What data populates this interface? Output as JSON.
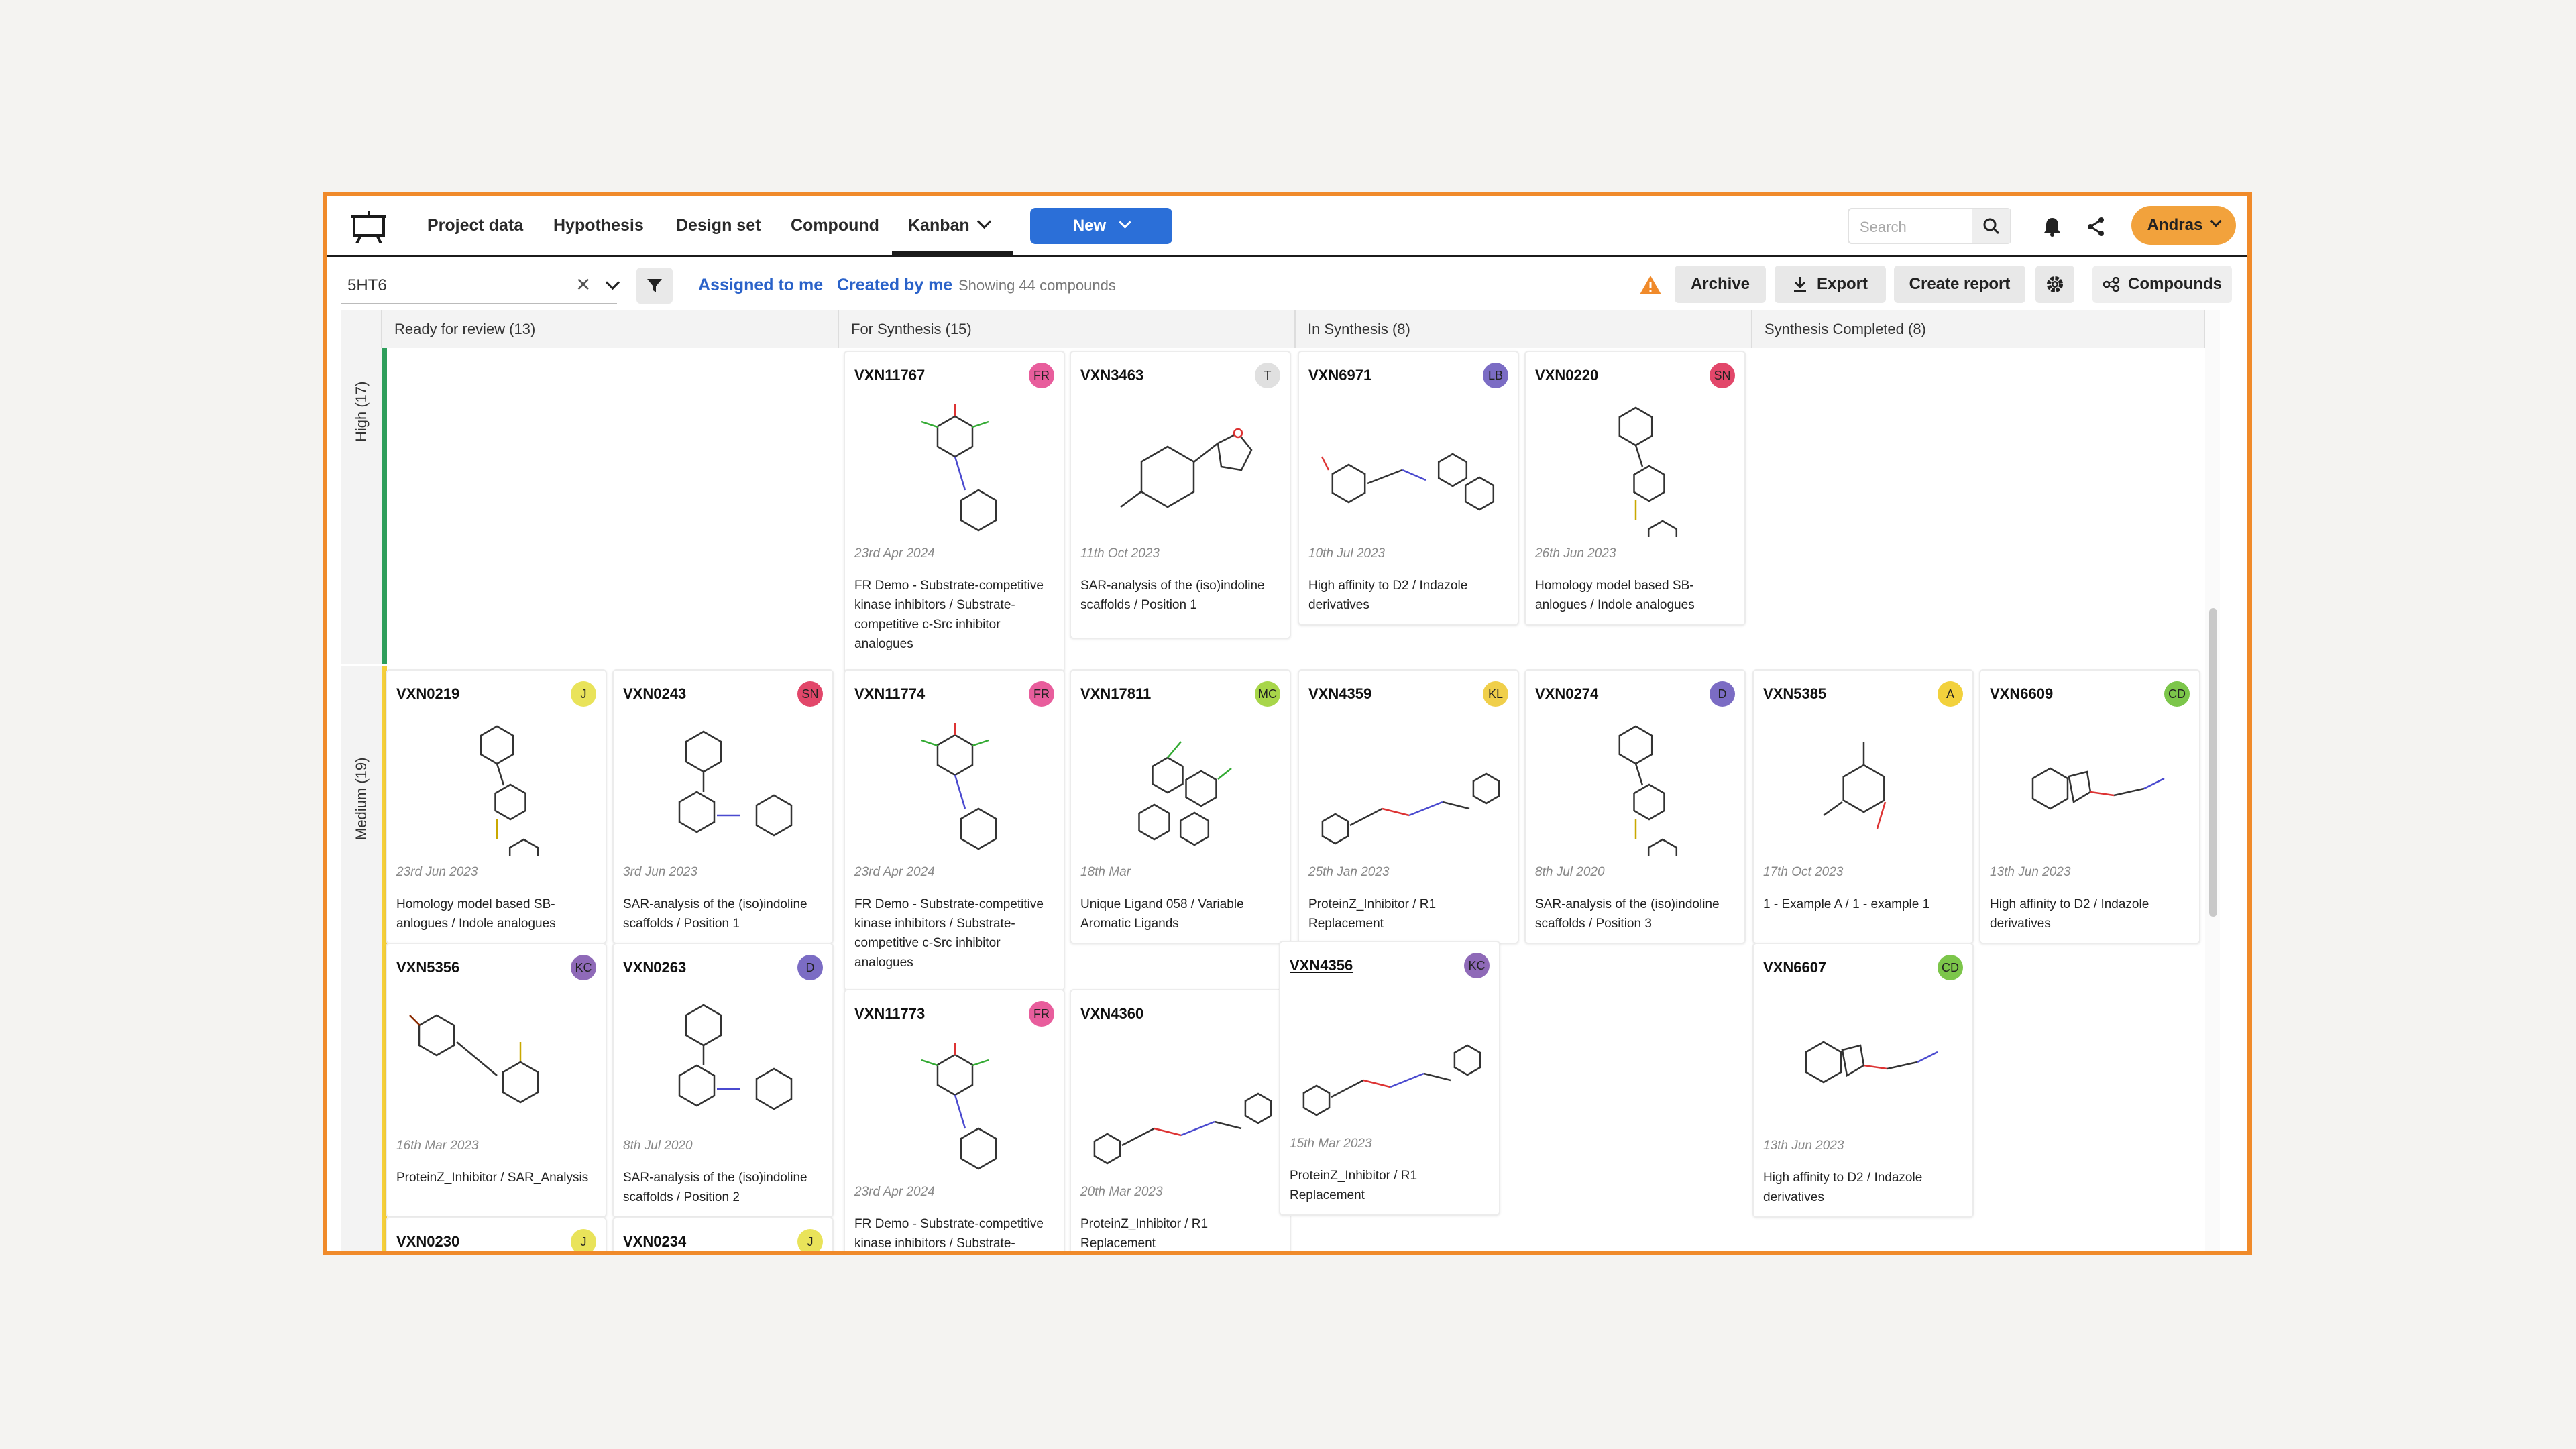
{
  "nav": {
    "items": [
      "Project data",
      "Hypothesis",
      "Design set",
      "Compound"
    ],
    "active": "Kanban",
    "new_label": "New",
    "search_placeholder": "Search",
    "user": "Andras"
  },
  "toolbar": {
    "project": "5HT6",
    "assigned": "Assigned to me",
    "created": "Created by me",
    "showing": "Showing 44 compounds",
    "archive": "Archive",
    "export": "Export",
    "report": "Create report",
    "compounds": "Compounds"
  },
  "columns": [
    "Ready for review (13)",
    "For Synthesis (15)",
    "In Synthesis (8)",
    "Synthesis Completed (8)"
  ],
  "rows": [
    "High (17)",
    "Medium (19)"
  ],
  "colors": {
    "accent": "#2b6fd8",
    "frame": "#f08a2a",
    "high_bar": "#2e9e5b",
    "medium_bar": "#f5cf3a",
    "badge_FR": "#e85d9c",
    "badge_T": "#e0e0e0",
    "badge_LB": "#7b6cc4",
    "badge_SN": "#e2476a",
    "badge_J": "#e9e35a",
    "badge_MC": "#a8d64a",
    "badge_KL": "#f0cf4a",
    "badge_D": "#7b6cc4",
    "badge_A": "#f2d13c",
    "badge_CD": "#7cc64a",
    "badge_KC": "#8f6ab8"
  },
  "cards": [
    {
      "id": "VXN11767",
      "badge": "FR",
      "date": "23rd Apr 2024",
      "desc": "FR Demo - Substrate-competitive kinase inhibitors / Substrate-competitive c-Src inhibitor analogues"
    },
    {
      "id": "VXN3463",
      "badge": "T",
      "date": "11th Oct 2023",
      "desc": "SAR-analysis of the (iso)indoline scaffolds / Position 1"
    },
    {
      "id": "VXN6971",
      "badge": "LB",
      "date": "10th Jul 2023",
      "desc": "High affinity to D2 / Indazole derivatives"
    },
    {
      "id": "VXN0220",
      "badge": "SN",
      "date": "26th Jun 2023",
      "desc": "Homology model based SB-anlogues / Indole analogues"
    },
    {
      "id": "VXN0219",
      "badge": "J",
      "date": "23rd Jun 2023",
      "desc": "Homology model based SB-anlogues / Indole analogues"
    },
    {
      "id": "VXN0243",
      "badge": "SN",
      "date": "3rd Jun 2023",
      "desc": "SAR-analysis of the (iso)indoline scaffolds / Position 1"
    },
    {
      "id": "VXN11774",
      "badge": "FR",
      "date": "23rd Apr 2024",
      "desc": "FR Demo - Substrate-competitive kinase inhibitors / Substrate-competitive c-Src inhibitor analogues"
    },
    {
      "id": "VXN17811",
      "badge": "MC",
      "date": "18th Mar",
      "desc": "Unique Ligand 058 / Variable Aromatic Ligands"
    },
    {
      "id": "VXN4359",
      "badge": "KL",
      "date": "25th Jan 2023",
      "desc": "ProteinZ_Inhibitor / R1 Replacement"
    },
    {
      "id": "VXN0274",
      "badge": "D",
      "date": "8th Jul 2020",
      "desc": "SAR-analysis of the (iso)indoline scaffolds / Position 3"
    },
    {
      "id": "VXN5385",
      "badge": "A",
      "date": "17th Oct 2023",
      "desc": "1 - Example A / 1 - example 1"
    },
    {
      "id": "VXN6609",
      "badge": "CD",
      "date": "13th Jun 2023",
      "desc": "High affinity to D2 / Indazole derivatives"
    },
    {
      "id": "VXN5356",
      "badge": "KC",
      "date": "16th Mar 2023",
      "desc": "ProteinZ_Inhibitor / SAR_Analysis"
    },
    {
      "id": "VXN0263",
      "badge": "D",
      "date": "8th Jul 2020",
      "desc": "SAR-analysis of the (iso)indoline scaffolds / Position 2"
    },
    {
      "id": "VXN11773",
      "badge": "FR",
      "date": "23rd Apr 2024",
      "desc": "FR Demo - Substrate-competitive kinase inhibitors / Substrate-"
    },
    {
      "id": "VXN4360",
      "badge": "",
      "date": "20th Mar 2023",
      "desc": "ProteinZ_Inhibitor / R1 Replacement"
    },
    {
      "id": "VXN4356",
      "badge": "KC",
      "date": "15th Mar 2023",
      "desc": "ProteinZ_Inhibitor / R1 Replacement"
    },
    {
      "id": "VXN6607",
      "badge": "CD",
      "date": "13th Jun 2023",
      "desc": "High affinity to D2 / Indazole derivatives"
    },
    {
      "id": "VXN0230",
      "badge": "J",
      "date": "",
      "desc": ""
    },
    {
      "id": "VXN0234",
      "badge": "J",
      "date": "",
      "desc": ""
    }
  ]
}
